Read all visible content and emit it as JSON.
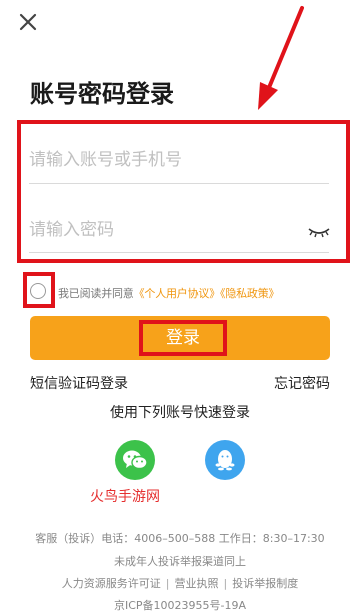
{
  "header": {
    "close_icon": "close-icon",
    "title": "账号密码登录"
  },
  "form": {
    "account_placeholder": "请输入账号或手机号",
    "password_placeholder": "请输入密码",
    "eye_icon": "eye-closed-icon"
  },
  "agreement": {
    "prefix": "我已阅读并同意",
    "user_agreement": "《个人用户协议》",
    "privacy_policy": "《隐私政策》",
    "checked": false
  },
  "login_button": "登录",
  "links": {
    "sms_login": "短信验证码登录",
    "forgot_password": "忘记密码"
  },
  "quick_login": {
    "label": "使用下列账号快速登录",
    "providers": [
      "wechat-icon",
      "qq-icon"
    ]
  },
  "watermark": "火鸟手游网",
  "footer": {
    "service": "客服（投诉）电话：4006–500–588 工作日：8:30–17:30",
    "minor_report": "未成年人投诉举报渠道同上",
    "links": [
      "人力资源服务许可证",
      "营业执照",
      "投诉举报制度"
    ],
    "icp": "京ICP备10023955号-19A"
  },
  "colors": {
    "accent": "#f7a21a",
    "highlight": "#e0131a",
    "link": "#f0960f",
    "wechat": "#3cc24a",
    "qq": "#3fa5ee"
  }
}
